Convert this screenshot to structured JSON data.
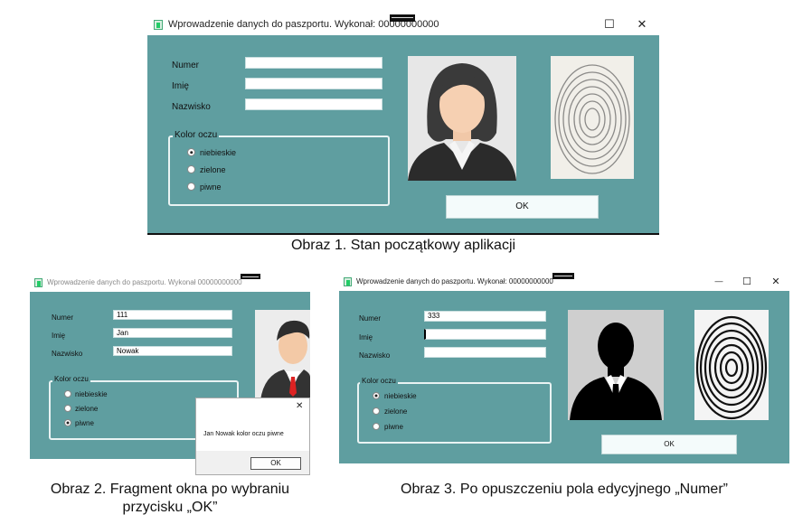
{
  "figure1": {
    "title": "Wprowadzenie danych do paszportu. Wykonał: 00000000000",
    "controls": {
      "minimize": "—",
      "maximize": "☐",
      "close": "✕"
    },
    "labels": {
      "numer": "Numer",
      "imie": "Imię",
      "nazwisko": "Nazwisko"
    },
    "values": {
      "numer": "",
      "imie": "",
      "nazwisko": ""
    },
    "eye_group": {
      "legend": "Kolor oczu",
      "options": [
        "niebieskie",
        "zielone",
        "piwne"
      ],
      "selected": "niebieskie"
    },
    "ok_button": "OK",
    "photo_icon": "woman-avatar-icon",
    "fingerprint_icon": "fingerprint-icon",
    "caption": "Obraz 1. Stan początkowy aplikacji"
  },
  "figure2": {
    "title": "Wprowadzenie danych do paszportu. Wykonał 00000000000",
    "labels": {
      "numer": "Numer",
      "imie": "Imię",
      "nazwisko": "Nazwisko"
    },
    "values": {
      "numer": "111",
      "imie": "Jan",
      "nazwisko": "Nowak"
    },
    "eye_group": {
      "legend": "Kolor oczu",
      "options": [
        "niebieskie",
        "zielone",
        "piwne"
      ],
      "selected": "piwne"
    },
    "photo_icon": "man-avatar-icon",
    "message_box": {
      "close": "✕",
      "text": "Jan Nowak kolor oczu piwne",
      "ok_button": "OK"
    },
    "caption_line1": "Obraz 2. Fragment okna po wybraniu",
    "caption_line2": "przycisku „OK”"
  },
  "figure3": {
    "title": "Wprowadzenie danych do paszportu. Wykonał: 00000000000",
    "controls": {
      "minimize": "—",
      "maximize": "☐",
      "close": "✕"
    },
    "labels": {
      "numer": "Numer",
      "imie": "Imię",
      "nazwisko": "Nazwisko"
    },
    "values": {
      "numer": "333",
      "imie": "",
      "nazwisko": ""
    },
    "eye_group": {
      "legend": "Kolor oczu",
      "options": [
        "niebieskie",
        "zielone",
        "piwne"
      ],
      "selected": "niebieskie"
    },
    "ok_button": "OK",
    "photo_icon": "man-silhouette-icon",
    "fingerprint_icon": "fingerprint-icon",
    "caption": "Obraz 3. Po opuszczeniu pola edycyjnego „Numer”"
  },
  "colors": {
    "window_bg": "#5f9ea0",
    "field_bg": "#ffffff",
    "button_bg": "#f4fbfb"
  }
}
